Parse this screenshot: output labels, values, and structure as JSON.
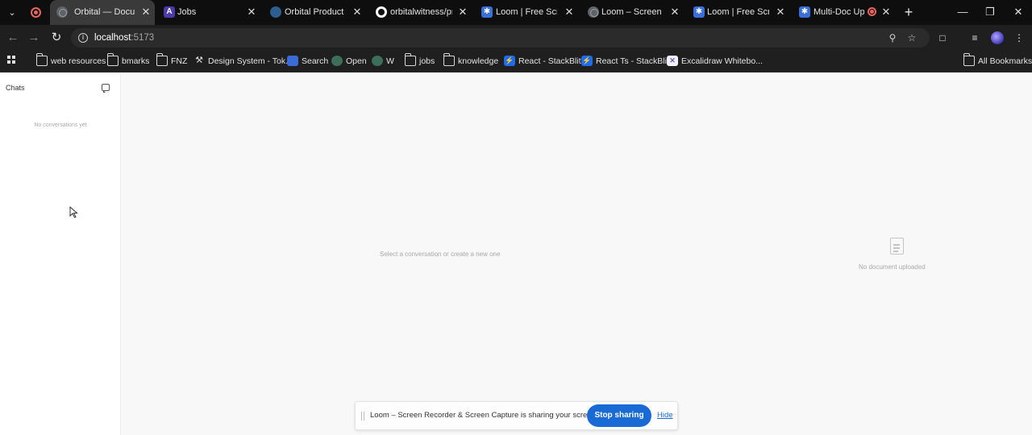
{
  "browser": {
    "tabs": [
      {
        "title": "Orbital — Documen",
        "active": true,
        "favicon": "globe-icon"
      },
      {
        "title": "Jobs",
        "active": false,
        "favicon": "a-logo-icon"
      },
      {
        "title": "Orbital Product Eng",
        "active": false,
        "favicon": "orbital-icon"
      },
      {
        "title": "orbitalwitness/prod",
        "active": false,
        "favicon": "github-icon"
      },
      {
        "title": "Loom | Free Screen",
        "active": false,
        "favicon": "loom-icon"
      },
      {
        "title": "Loom – Screen Rec",
        "active": false,
        "favicon": "globe-icon"
      },
      {
        "title": "Loom | Free Screen",
        "active": false,
        "favicon": "loom-icon"
      },
      {
        "title": "Multi-Doc Uplo",
        "active": false,
        "favicon": "loom-icon",
        "recording": true
      }
    ],
    "address": {
      "host": "localhost",
      "port": ":5173"
    },
    "bookmarks": [
      {
        "label": "web resources",
        "icon": "folder-icon"
      },
      {
        "label": "bmarks",
        "icon": "folder-icon"
      },
      {
        "label": "FNZ",
        "icon": "folder-icon"
      },
      {
        "label": "Design System - Tok...",
        "icon": "tools-icon"
      },
      {
        "label": "Search",
        "icon": "search-site-icon"
      },
      {
        "label": "Open",
        "icon": "globe-icon"
      },
      {
        "label": "W",
        "icon": "globe-icon"
      },
      {
        "label": "jobs",
        "icon": "folder-icon"
      },
      {
        "label": "knowledge",
        "icon": "folder-icon"
      },
      {
        "label": "React - StackBlitz",
        "icon": "stackblitz-icon"
      },
      {
        "label": "React Ts - StackBlitz",
        "icon": "stackblitz-icon"
      },
      {
        "label": "Excalidraw Whitebo...",
        "icon": "excalidraw-icon"
      }
    ],
    "all_bookmarks": "All Bookmarks"
  },
  "app": {
    "sidebar": {
      "title": "Chats",
      "empty": "No conversations yet"
    },
    "main": {
      "empty": "Select a conversation or create a new one"
    },
    "document_panel": {
      "empty": "No document uploaded"
    }
  },
  "loom_bar": {
    "message": "Loom – Screen Recorder & Screen Capture is sharing your screen.",
    "stop_label": "Stop sharing",
    "hide_label": "Hide"
  }
}
